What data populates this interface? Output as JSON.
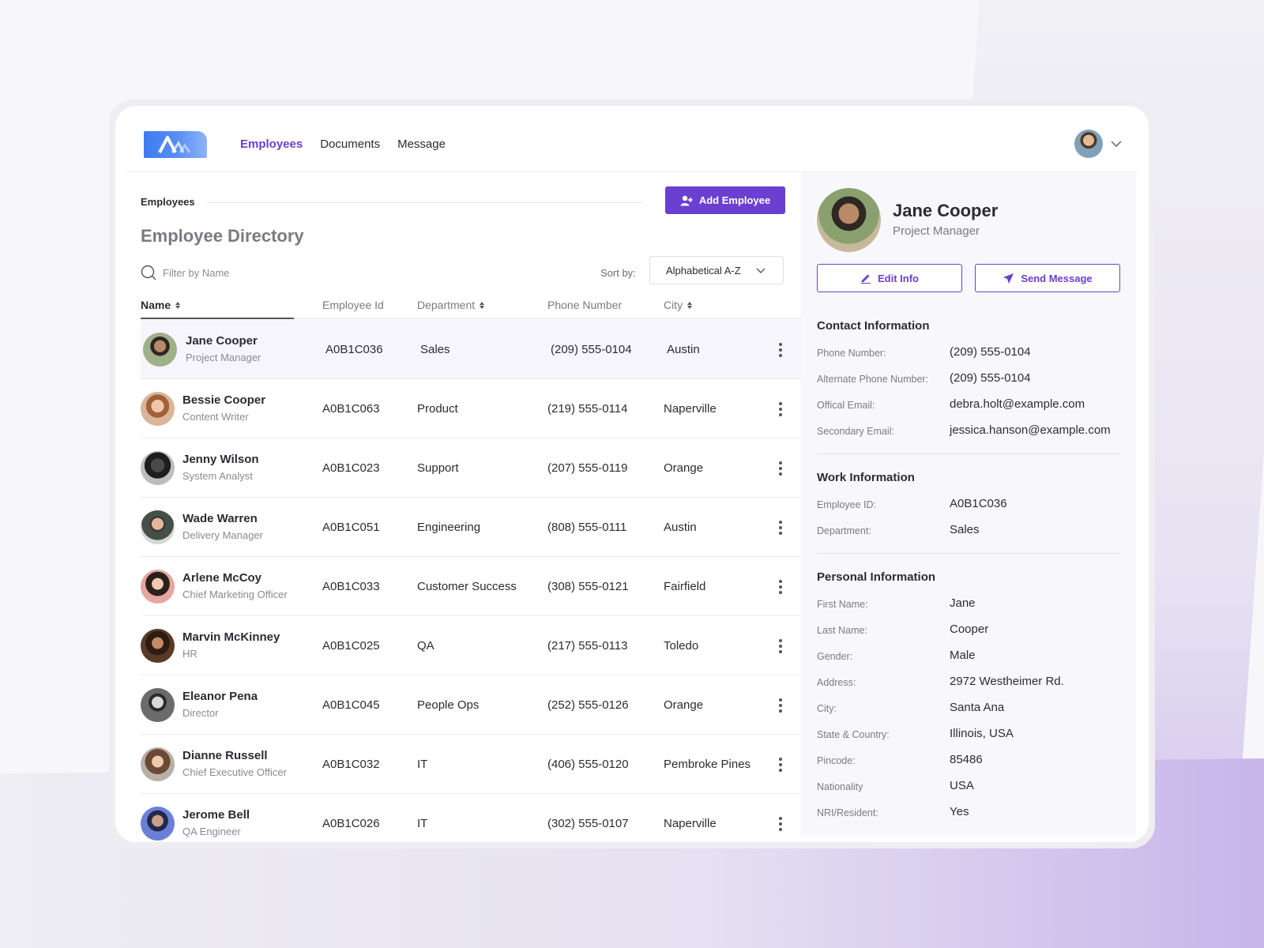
{
  "nav": {
    "items": [
      {
        "label": "Employees",
        "active": true
      },
      {
        "label": "Documents",
        "active": false
      },
      {
        "label": "Message",
        "active": false
      }
    ]
  },
  "breadcrumb": "Employees",
  "add_button": "Add Employee",
  "page_title": "Employee Directory",
  "filter": {
    "placeholder": "Filter by Name"
  },
  "sort": {
    "label": "Sort by:",
    "value": "Alphabetical A-Z"
  },
  "columns": [
    "Name",
    "Employee Id",
    "Department",
    "Phone Number",
    "City"
  ],
  "employees": [
    {
      "name": "Jane Cooper",
      "role": "Project Manager",
      "id": "A0B1C036",
      "dept": "Sales",
      "phone": "(209) 555-0104",
      "city": "Austin"
    },
    {
      "name": "Bessie Cooper",
      "role": "Content Writer",
      "id": "A0B1C063",
      "dept": "Product",
      "phone": "(219) 555-0114",
      "city": "Naperville"
    },
    {
      "name": "Jenny Wilson",
      "role": "System Analyst",
      "id": "A0B1C023",
      "dept": "Support",
      "phone": "(207) 555-0119",
      "city": "Orange"
    },
    {
      "name": "Wade Warren",
      "role": "Delivery Manager",
      "id": "A0B1C051",
      "dept": "Engineering",
      "phone": "(808) 555-0111",
      "city": "Austin"
    },
    {
      "name": "Arlene McCoy",
      "role": "Chief Marketing Officer",
      "id": "A0B1C033",
      "dept": "Customer Success",
      "phone": "(308) 555-0121",
      "city": "Fairfield"
    },
    {
      "name": "Marvin McKinney",
      "role": "HR",
      "id": "A0B1C025",
      "dept": "QA",
      "phone": "(217) 555-0113",
      "city": "Toledo"
    },
    {
      "name": "Eleanor Pena",
      "role": "Director",
      "id": "A0B1C045",
      "dept": "People Ops",
      "phone": "(252) 555-0126",
      "city": "Orange"
    },
    {
      "name": "Dianne Russell",
      "role": "Chief Executive Officer",
      "id": "A0B1C032",
      "dept": "IT",
      "phone": "(406) 555-0120",
      "city": "Pembroke Pines"
    },
    {
      "name": "Jerome Bell",
      "role": "QA Engineer",
      "id": "A0B1C026",
      "dept": "IT",
      "phone": "(302) 555-0107",
      "city": "Naperville"
    }
  ],
  "profile": {
    "name": "Jane Cooper",
    "role": "Project Manager",
    "edit_button": "Edit Info",
    "message_button": "Send Message",
    "contact": {
      "title": "Contact Information",
      "rows": [
        {
          "label": "Phone Number:",
          "value": "(209) 555-0104"
        },
        {
          "label": "Alternate Phone Number:",
          "value": "(209) 555-0104"
        },
        {
          "label": "Offical Email:",
          "value": "debra.holt@example.com"
        },
        {
          "label": "Secondary Email:",
          "value": "jessica.hanson@example.com"
        }
      ]
    },
    "work": {
      "title": "Work Information",
      "rows": [
        {
          "label": "Employee ID:",
          "value": "A0B1C036"
        },
        {
          "label": "Department:",
          "value": "Sales"
        }
      ]
    },
    "personal": {
      "title": "Personal Information",
      "rows": [
        {
          "label": "First Name:",
          "value": "Jane"
        },
        {
          "label": "Last Name:",
          "value": "Cooper"
        },
        {
          "label": "Gender:",
          "value": "Male"
        },
        {
          "label": "Address:",
          "value": "2972 Westheimer Rd."
        },
        {
          "label": "City:",
          "value": "Santa Ana"
        },
        {
          "label": "State & Country:",
          "value": "Illinois, USA"
        },
        {
          "label": "Pincode:",
          "value": "85486"
        },
        {
          "label": "Nationality",
          "value": "USA"
        },
        {
          "label": "NRI/Resident:",
          "value": "Yes"
        }
      ]
    }
  },
  "colors": {
    "accent": "#6b3fd1",
    "logo": "#3d7cf0"
  }
}
